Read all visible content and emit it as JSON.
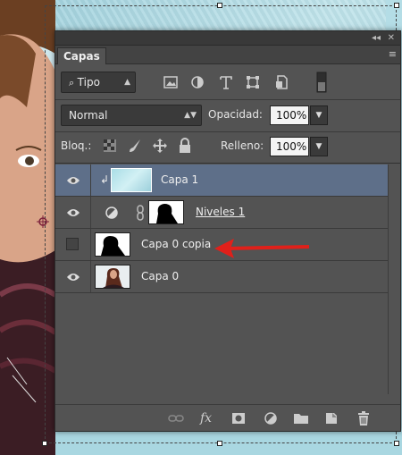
{
  "panel": {
    "tab_label": "Capas",
    "collapse_glyph": "◂◂",
    "close_glyph": "✕",
    "menu_glyph": "≡",
    "filter": {
      "label": "Tipo",
      "icon": "search-icon"
    },
    "blend_mode": "Normal",
    "opacity_label": "Opacidad:",
    "opacity_value": "100%",
    "lock_label": "Bloq.:",
    "fill_label": "Relleno:",
    "fill_value": "100%"
  },
  "layers": [
    {
      "name": "Capa 1",
      "selected": true,
      "visible": true,
      "clipped": true
    },
    {
      "name": "Niveles 1",
      "selected": false,
      "visible": true,
      "adjustment": true
    },
    {
      "name": "Capa 0 copia",
      "selected": false,
      "visible": false
    },
    {
      "name": "Capa 0",
      "selected": false,
      "visible": true
    }
  ],
  "colors": {
    "selected_row": "#5e6f89",
    "arrow": "#e0201a",
    "panel_bg": "#535353"
  }
}
